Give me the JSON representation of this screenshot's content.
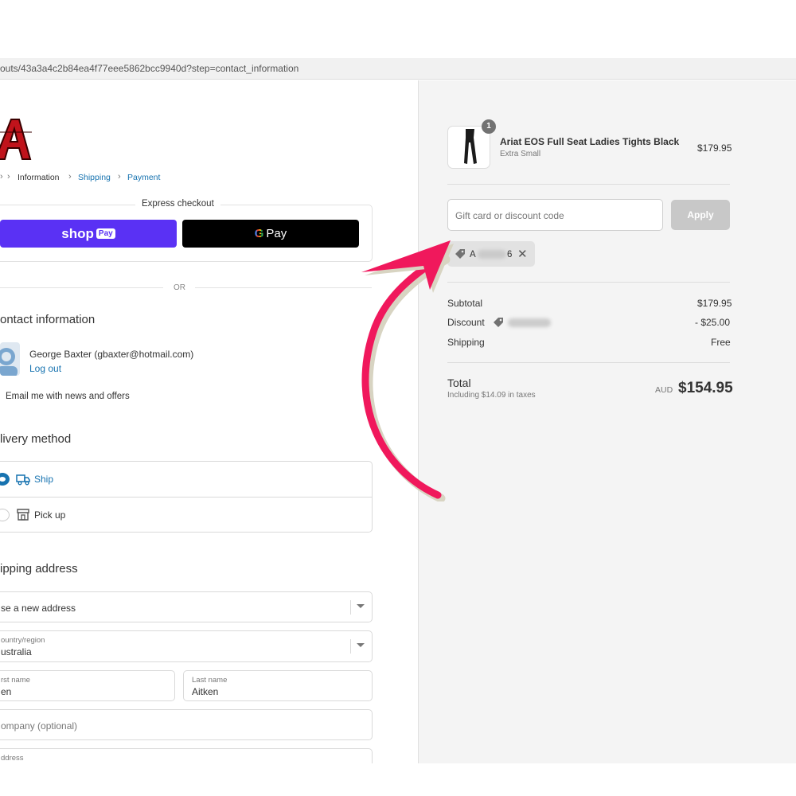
{
  "browser": {
    "url": "outs/43a3a4c2b84ea4f77eee5862bcc9940d?step=contact_information"
  },
  "breadcrumb": {
    "items": [
      "Information",
      "Shipping",
      "Payment"
    ]
  },
  "express_checkout": {
    "title": "Express checkout",
    "shop_pay_label": "shop",
    "shop_pay_pill": "Pay",
    "gpay_g": "G",
    "gpay_label": "Pay",
    "or_label": "OR"
  },
  "contact": {
    "heading": "ontact information",
    "user": "George Baxter (gbaxter@hotmail.com)",
    "logout": "Log out",
    "email_opt_in": "Email me with news and offers"
  },
  "delivery": {
    "heading": "livery method",
    "options": [
      {
        "label": "Ship",
        "selected": true
      },
      {
        "label": "Pick up",
        "selected": false
      }
    ]
  },
  "shipping_address": {
    "heading": "ipping address",
    "saved_address": "se a new address",
    "country_label": "ountry/region",
    "country_value": "ustralia",
    "first_name_label": "rst name",
    "first_name_value": "en",
    "last_name_label": "Last name",
    "last_name_value": "Aitken",
    "company_placeholder": "ompany (optional)",
    "address_label": "ddress"
  },
  "cart": {
    "item": {
      "quantity": "1",
      "name": "Ariat EOS Full Seat Ladies Tights Black",
      "variant": "Extra Small",
      "price": "$179.95"
    },
    "discount_placeholder": "Gift card or discount code",
    "apply_label": "Apply",
    "applied_code_visible_start": "A",
    "applied_code_visible_end": "6",
    "close_symbol": "✕",
    "summary": [
      {
        "label": "Subtotal",
        "value": "$179.95"
      },
      {
        "label": "Discount",
        "value": "- $25.00"
      },
      {
        "label": "Shipping",
        "value": "Free"
      }
    ],
    "total_label": "Total",
    "tax_note": "Including $14.09 in taxes",
    "currency": "AUD",
    "total": "$154.95"
  },
  "colors": {
    "accent": "#1773b0",
    "shop_pay": "#5a31f4",
    "annotation_arrow": "#f0185c"
  }
}
